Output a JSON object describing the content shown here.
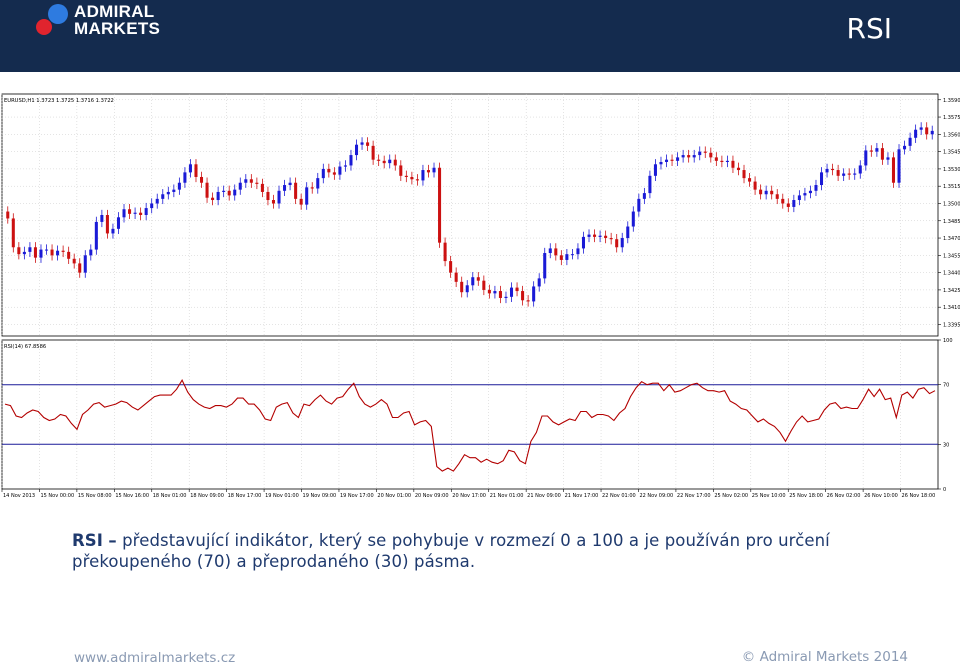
{
  "header": {
    "logo_line1": "ADMIRAL",
    "logo_line2": "MARKETS",
    "title": "RSI",
    "background": "#142b4e"
  },
  "chart_data": {
    "type": "candlestick",
    "instrument_label": "EURUSD,H1  1.3723 1.3725 1.3716 1.3722",
    "rsi_label": "RSI(14) 67.8586",
    "colors": {
      "up": "#1a1ad6",
      "down": "#cc1111",
      "rsi_line": "#b30000",
      "levels": "#1a1a99"
    },
    "price_axis": {
      "ylim": [
        1.3385,
        1.3595
      ],
      "ticks": [
        "1.3590",
        "1.3575",
        "1.3560",
        "1.3545",
        "1.3530",
        "1.3515",
        "1.3500",
        "1.3485",
        "1.3470",
        "1.3455",
        "1.3440",
        "1.3425",
        "1.3410",
        "1.3395"
      ]
    },
    "rsi_axis": {
      "ylim": [
        0,
        100
      ],
      "ticks": [
        "100",
        "70",
        "30",
        "0"
      ],
      "levels": [
        70,
        30
      ]
    },
    "x_ticks": [
      "14 Nov 2013",
      "15 Nov 00:00",
      "15 Nov 08:00",
      "15 Nov 16:00",
      "18 Nov 01:00",
      "18 Nov 09:00",
      "18 Nov 17:00",
      "19 Nov 01:00",
      "19 Nov 09:00",
      "19 Nov 17:00",
      "20 Nov 01:00",
      "20 Nov 09:00",
      "20 Nov 17:00",
      "21 Nov 01:00",
      "21 Nov 09:00",
      "21 Nov 17:00",
      "22 Nov 01:00",
      "22 Nov 09:00",
      "22 Nov 17:00",
      "25 Nov 02:00",
      "25 Nov 10:00",
      "25 Nov 18:00",
      "26 Nov 02:00",
      "26 Nov 10:00",
      "26 Nov 18:00"
    ],
    "close": [
      1.3487,
      1.3462,
      1.3456,
      1.3458,
      1.3462,
      1.3453,
      1.346,
      1.346,
      1.3455,
      1.3459,
      1.3458,
      1.3452,
      1.3448,
      1.344,
      1.3455,
      1.346,
      1.3484,
      1.349,
      1.3474,
      1.3478,
      1.3488,
      1.3495,
      1.3491,
      1.3492,
      1.349,
      1.3496,
      1.35,
      1.3504,
      1.3508,
      1.351,
      1.3512,
      1.3518,
      1.3527,
      1.3534,
      1.3523,
      1.3518,
      1.3505,
      1.3503,
      1.351,
      1.3511,
      1.3507,
      1.3512,
      1.3518,
      1.3521,
      1.3518,
      1.3517,
      1.351,
      1.3503,
      1.35,
      1.3511,
      1.3516,
      1.3518,
      1.3504,
      1.3499,
      1.3514,
      1.3513,
      1.3522,
      1.353,
      1.3527,
      1.3525,
      1.3532,
      1.3533,
      1.3542,
      1.3551,
      1.3553,
      1.355,
      1.3538,
      1.3537,
      1.3535,
      1.3538,
      1.3533,
      1.3524,
      1.3523,
      1.3521,
      1.352,
      1.3529,
      1.3527,
      1.3531,
      1.3466,
      1.345,
      1.344,
      1.3432,
      1.3423,
      1.3429,
      1.3436,
      1.3433,
      1.3425,
      1.3422,
      1.3424,
      1.3418,
      1.3419,
      1.3427,
      1.3424,
      1.3416,
      1.3415,
      1.3428,
      1.3435,
      1.3457,
      1.3461,
      1.3455,
      1.3451,
      1.3456,
      1.3456,
      1.3461,
      1.3471,
      1.3473,
      1.3471,
      1.3472,
      1.347,
      1.3469,
      1.3462,
      1.347,
      1.348,
      1.3493,
      1.3504,
      1.3509,
      1.3524,
      1.3534,
      1.3536,
      1.3538,
      1.3537,
      1.354,
      1.3542,
      1.354,
      1.3542,
      1.3545,
      1.3544,
      1.354,
      1.3537,
      1.3536,
      1.3537,
      1.3531,
      1.3529,
      1.3522,
      1.3519,
      1.3512,
      1.3508,
      1.3511,
      1.3508,
      1.3504,
      1.35,
      1.3497,
      1.3503,
      1.3507,
      1.3509,
      1.3511,
      1.3516,
      1.3527,
      1.353,
      1.3529,
      1.3524,
      1.3526,
      1.3525,
      1.3526,
      1.3533,
      1.3546,
      1.3545,
      1.3548,
      1.3538,
      1.354,
      1.3518,
      1.3547,
      1.355,
      1.3557,
      1.3564,
      1.3566,
      1.356,
      1.3563
    ],
    "rsi": [
      57,
      56,
      49,
      48,
      51,
      53,
      52,
      48,
      46,
      47,
      50,
      49,
      44,
      40,
      50,
      53,
      57,
      58,
      55,
      56,
      57,
      59,
      58,
      55,
      53,
      56,
      59,
      62,
      63,
      63,
      63,
      67,
      73,
      65,
      60,
      57,
      55,
      54,
      56,
      56,
      55,
      57,
      61,
      61,
      57,
      57,
      53,
      47,
      46,
      55,
      57,
      58,
      51,
      48,
      57,
      56,
      60,
      63,
      59,
      57,
      61,
      62,
      67,
      71,
      62,
      57,
      55,
      57,
      60,
      57,
      48,
      48,
      51,
      52,
      43,
      45,
      46,
      42,
      15,
      12,
      14,
      12,
      17,
      23,
      21,
      21,
      18,
      20,
      18,
      17,
      19,
      26,
      25,
      19,
      17,
      32,
      38,
      49,
      49,
      45,
      43,
      45,
      47,
      46,
      52,
      52,
      48,
      50,
      50,
      49,
      46,
      51,
      54,
      62,
      68,
      72,
      70,
      71,
      71,
      66,
      70,
      65,
      66,
      68,
      70,
      71,
      68,
      66,
      66,
      65,
      66,
      59,
      57,
      54,
      53,
      49,
      45,
      47,
      44,
      42,
      38,
      32,
      39,
      45,
      49,
      45,
      46,
      47,
      53,
      57,
      58,
      54,
      55,
      54,
      54,
      60,
      67,
      62,
      67,
      60,
      61,
      48,
      63,
      65,
      61,
      67,
      68,
      64,
      66
    ]
  },
  "caption": {
    "term": "RSI",
    "dash": "–",
    "line1": " představující indikátor, který se pohybuje v rozmezí 0 a 100 a je používán pro určení",
    "line2": "překoupeného (70) a přeprodaného (30) pásma."
  },
  "footer": {
    "website": "www.admiralmarkets.cz",
    "copyright": "© Admiral Markets 2014"
  }
}
